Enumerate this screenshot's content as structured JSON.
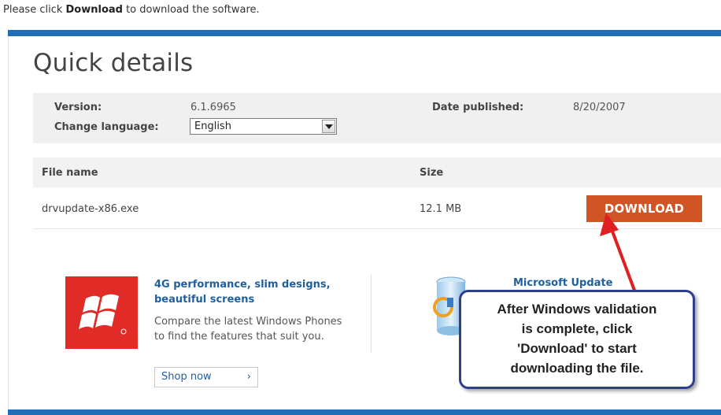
{
  "intro": {
    "before": "Please click ",
    "bold": "Download",
    "after": " to download the software."
  },
  "page_title": "Quick details",
  "details": {
    "version_label": "Version:",
    "version_value": "6.1.6965",
    "language_label": "Change language:",
    "language_value": "English",
    "date_label": "Date published:",
    "date_value": "8/20/2007"
  },
  "files": {
    "col_name": "File name",
    "col_size": "Size",
    "rows": [
      {
        "name": "drvupdate-x86.exe",
        "size": "12.1 MB"
      }
    ],
    "download_label": "DOWNLOAD"
  },
  "promo": {
    "title": "4G performance, slim designs, beautiful screens",
    "text": "Compare the latest Windows Phones to find the features that suit you.",
    "shop_label": "Shop now",
    "shop_arrow": "›",
    "icon": "windows-phone-logo-icon"
  },
  "microsoft_update": {
    "title": "Microsoft Update",
    "icon": "microsoft-update-icon"
  },
  "callout": {
    "lines": [
      "After Windows validation",
      "is complete, click",
      "'Download' to start",
      "downloading the file."
    ],
    "border_color": "#2f3f8c"
  },
  "colors": {
    "accent_bar": "#1f6eb5",
    "download_button": "#d05424",
    "link": "#1f5f9f",
    "arrow": "#e02020"
  }
}
